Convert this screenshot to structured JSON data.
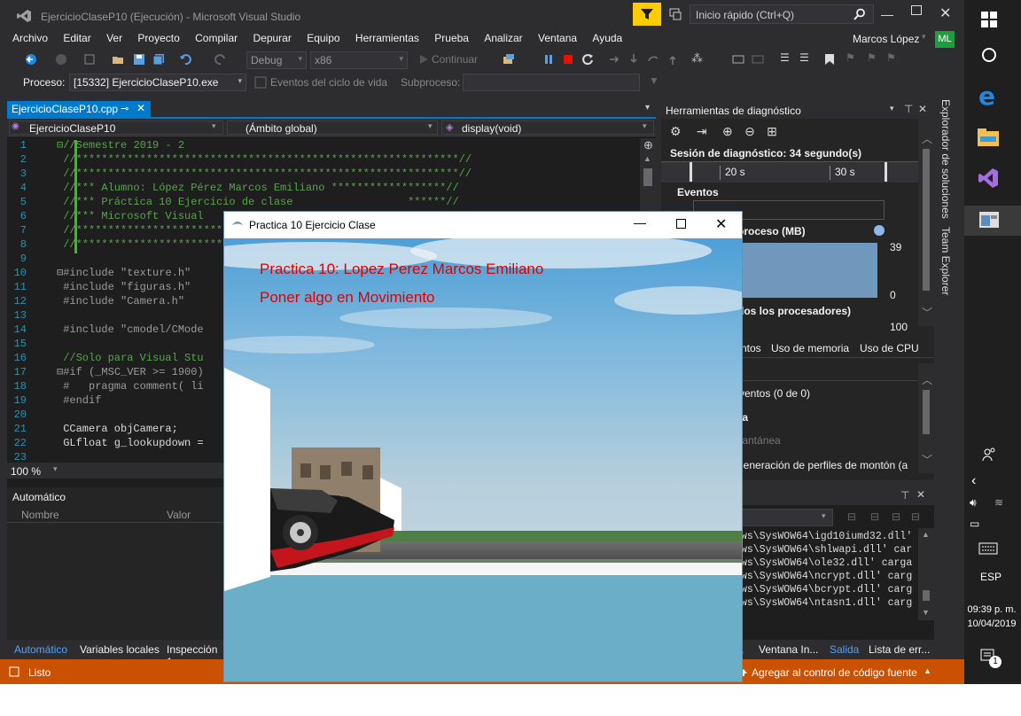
{
  "vs": {
    "window_title": "EjercicioClaseP10 (Ejecución) - Microsoft Visual Studio",
    "quick_launch_placeholder": "Inicio rápido (Ctrl+Q)",
    "user_name": "Marcos López",
    "user_initials": "ML",
    "menu": [
      "Archivo",
      "Editar",
      "Ver",
      "Proyecto",
      "Compilar",
      "Depurar",
      "Equipo",
      "Herramientas",
      "Prueba",
      "Analizar",
      "Ventana",
      "Ayuda"
    ],
    "toolbar": {
      "config": "Debug",
      "platform": "x86",
      "continue_label": "Continuar"
    },
    "process": {
      "label": "Proceso:",
      "value": "[15332] EjercicioClaseP10.exe",
      "lifecycle_label": "Eventos del ciclo de vida",
      "thread_label": "Subproceso:"
    },
    "editor": {
      "tab": "EjercicioClaseP10.cpp",
      "project_combo": "EjercicioClaseP10",
      "scope_combo": "(Ámbito global)",
      "member_combo": "display(void)",
      "zoom": "100 %",
      "lines": [
        {
          "n": "1",
          "text": "⊟//Semestre 2019 - 2",
          "cls": "cm"
        },
        {
          "n": "2",
          "text": " //************************************************************//",
          "cls": "cm"
        },
        {
          "n": "3",
          "text": " //************************************************************//",
          "cls": "cm"
        },
        {
          "n": "4",
          "text": " //*** Alumno: López Pérez Marcos Emiliano ******************//",
          "cls": "cm"
        },
        {
          "n": "5",
          "text": " //*** Práctica 10 Ejercicio de clase                  ******//",
          "cls": "cm"
        },
        {
          "n": "6",
          "text": " //*** Microsoft Visual",
          "cls": "cm"
        },
        {
          "n": "7",
          "text": " //*************************",
          "cls": "cm"
        },
        {
          "n": "8",
          "text": " //*************************",
          "cls": "cm"
        },
        {
          "n": "9",
          "text": "",
          "cls": "tx"
        },
        {
          "n": "10",
          "text": "⊟#include \"texture.h\"",
          "cls": "pp"
        },
        {
          "n": "11",
          "text": " #include \"figuras.h\"",
          "cls": "pp"
        },
        {
          "n": "12",
          "text": " #include \"Camera.h\"",
          "cls": "pp"
        },
        {
          "n": "13",
          "text": "",
          "cls": "tx"
        },
        {
          "n": "14",
          "text": " #include \"cmodel/CMode",
          "cls": "pp"
        },
        {
          "n": "15",
          "text": "",
          "cls": "tx"
        },
        {
          "n": "16",
          "text": " //Solo para Visual Stu",
          "cls": "cm"
        },
        {
          "n": "17",
          "text": "⊟#if (_MSC_VER >= 1900)",
          "cls": "pp"
        },
        {
          "n": "18",
          "text": " #   pragma comment( li",
          "cls": "pp"
        },
        {
          "n": "19",
          "text": " #endif",
          "cls": "pp"
        },
        {
          "n": "20",
          "text": "",
          "cls": "tx"
        },
        {
          "n": "21",
          "text": " CCamera objCamera;",
          "cls": "tx"
        },
        {
          "n": "22",
          "text": " GLfloat g_lookupdown =",
          "cls": "tx"
        },
        {
          "n": "23",
          "text": "",
          "cls": "tx"
        }
      ]
    },
    "diag": {
      "title": "Herramientas de diagnóstico",
      "session": "Sesión de diagnóstico: 34 segundo(s)",
      "tick1": "20 s",
      "tick2": "30 s",
      "events": "Eventos",
      "process_mem": "proceso (MB)",
      "mem_max": "39",
      "mem_min": "0",
      "cpu_label": "dos los procesadores)",
      "cpu_max": "100",
      "tabs": [
        "ntos",
        "Uso de memoria",
        "Uso de CPU"
      ],
      "rows": [
        "ventos (0 de 0)",
        "ia",
        "tantánea",
        "generación de perfiles de montón (a"
      ]
    },
    "auto": {
      "title": "Automático",
      "col_name": "Nombre",
      "col_value": "Valor",
      "tabs": [
        "Automático",
        "Variables locales",
        "Inspección 1"
      ]
    },
    "output": {
      "lines": [
        "ws\\SysWOW64\\igd10iumd32.dll'",
        "ws\\SysWOW64\\shlwapi.dll' car",
        "ws\\SysWOW64\\ole32.dll' carga",
        "ws\\SysWOW64\\ncrypt.dll' carg",
        "ws\\SysWOW64\\bcrypt.dll' carg",
        "ws\\SysWOW64\\ntasn1.dll' carg"
      ],
      "tabs": [
        ".",
        "Ventana In...",
        "Salida",
        "Lista de err..."
      ]
    },
    "status": {
      "ready": "Listo",
      "source_control": "Agregar al control de código fuente"
    },
    "side_tabs": [
      "Explorador de soluciones",
      "Team Explorer"
    ]
  },
  "taskbar": {
    "lang": "ESP",
    "time": "09:39 p. m.",
    "date": "10/04/2019",
    "notif_count": "1"
  },
  "glwin": {
    "title": "Practica 10 Ejercicio Clase",
    "line1": "Practica 10: Lopez Perez Marcos Emiliano",
    "line2": "Poner algo en Movimiento"
  },
  "colors": {
    "vs_dark": "#2d2d30",
    "status_orange": "#ca5100",
    "editor_bg": "#1e1e1e",
    "accent_blue": "#007acc",
    "overlay_red": "#e00000"
  }
}
